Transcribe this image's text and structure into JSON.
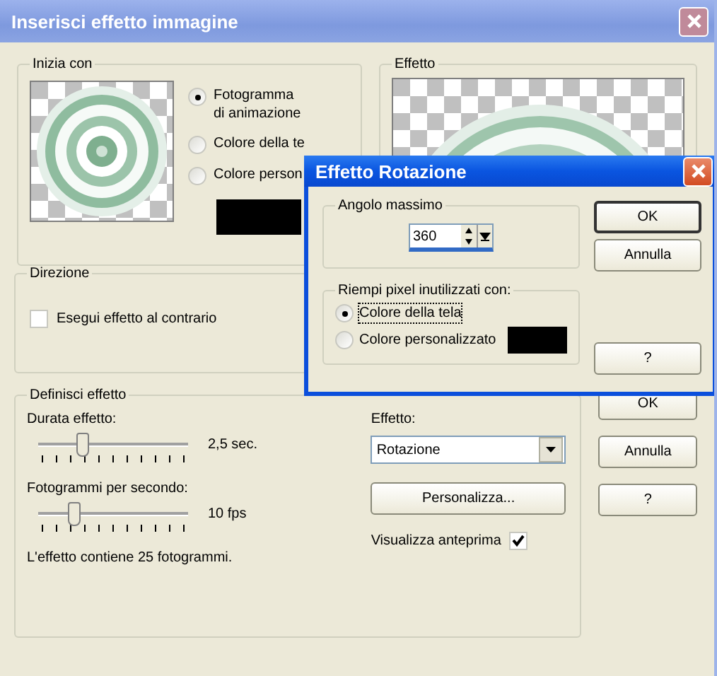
{
  "window": {
    "title": "Inserisci effetto immagine"
  },
  "start_with": {
    "label": "Inizia con",
    "options": [
      {
        "label": "Fotogramma\ndi animazione",
        "selected": true
      },
      {
        "label": "Colore della te",
        "selected": false
      },
      {
        "label": "Colore person",
        "selected": false
      }
    ]
  },
  "effect_preview": {
    "label": "Effetto"
  },
  "direction": {
    "label": "Direzione",
    "reverse": {
      "label": "Esegui effetto al contrario",
      "checked": false
    }
  },
  "define": {
    "label": "Definisci effetto",
    "sliders": [
      {
        "label": "Durata effetto:",
        "level": 0.29,
        "reading": "2,5 sec."
      },
      {
        "label": "Fotogrammi per secondo:",
        "level": 0.24,
        "reading": "10 fps"
      }
    ],
    "summary": "L'effetto contiene 25 fotogrammi.",
    "effect_label": "Effetto:",
    "effect_value": "Rotazione",
    "customize_button": "Personalizza...",
    "preview_toggle": {
      "label": "Visualizza anteprima",
      "checked": true
    }
  },
  "buttons": [
    "OK",
    "Annulla",
    "?"
  ],
  "rotation_dialog": {
    "title": "Effetto Rotazione",
    "angle": {
      "label": "Angolo massimo",
      "value": "360"
    },
    "fill": {
      "label": "Riempi pixel inutilizzati con:",
      "options": [
        {
          "label": "Colore della tela",
          "selected": true
        },
        {
          "label": "Colore personalizzato",
          "selected": false
        }
      ]
    },
    "buttons": [
      "OK",
      "Annulla",
      "?"
    ]
  }
}
